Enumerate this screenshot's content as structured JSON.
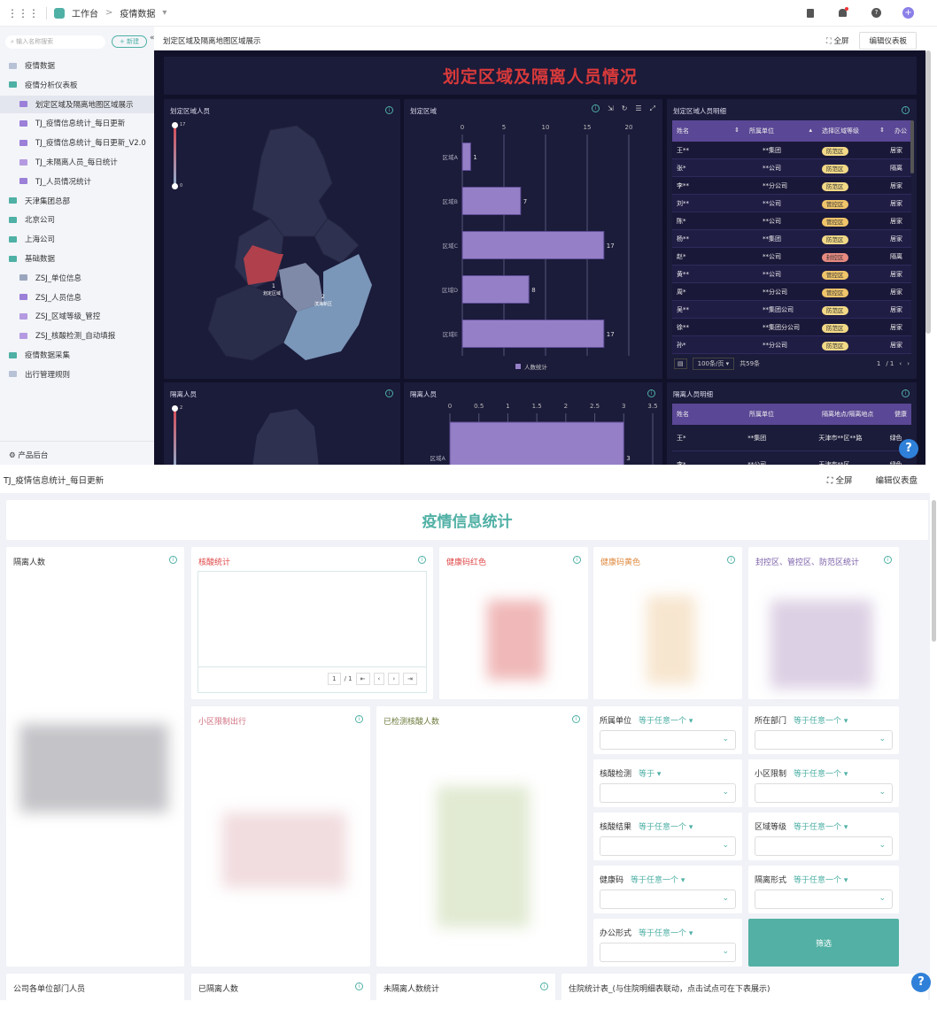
{
  "topbar": {
    "workspace": "工作台",
    "separator": ">",
    "project": "疫情数据"
  },
  "sidebar": {
    "search_placeholder": "输入名称搜索",
    "new_label": "+ 新建",
    "collapse": "«",
    "items": [
      {
        "label": "疫情数据",
        "type": "sheet",
        "indent": 0
      },
      {
        "label": "疫情分析仪表板",
        "type": "folder",
        "indent": 0
      },
      {
        "label": "划定区域及隔离地图区域展示",
        "type": "dashboard",
        "indent": 1,
        "selected": true
      },
      {
        "label": "TJ_疫情信息统计_每日更新",
        "type": "dashboard",
        "indent": 1
      },
      {
        "label": "TJ_疫情信息统计_每日更新_V2.0",
        "type": "dashboard",
        "indent": 1
      },
      {
        "label": "TJ_未隔离人员_每日统计",
        "type": "report",
        "indent": 1
      },
      {
        "label": "TJ_人员情况统计",
        "type": "user",
        "indent": 1
      },
      {
        "label": "天津集团总部",
        "type": "folder",
        "indent": 0
      },
      {
        "label": "北京公司",
        "type": "folder",
        "indent": 0
      },
      {
        "label": "上海公司",
        "type": "folder",
        "indent": 0
      },
      {
        "label": "基础数据",
        "type": "folder",
        "indent": 0
      },
      {
        "label": "ZSJ_单位信息",
        "type": "globe",
        "indent": 1
      },
      {
        "label": "ZSJ_人员信息",
        "type": "user",
        "indent": 1
      },
      {
        "label": "ZSJ_区域等级_管控",
        "type": "report",
        "indent": 1
      },
      {
        "label": "ZSJ_核酸检测_自动填报",
        "type": "report",
        "indent": 1
      },
      {
        "label": "疫情数据采集",
        "type": "folder",
        "indent": 0
      },
      {
        "label": "出行管理规则",
        "type": "sheet",
        "indent": 0
      }
    ],
    "footer": "产品后台"
  },
  "dashboard1": {
    "breadcrumb": "划定区域及隔离地图区域展示",
    "fullscreen": "全屏",
    "edit": "编辑仪表板",
    "title": "划定区域及隔离人员情况",
    "map1": {
      "title": "划定区域人员",
      "legend_max": "17",
      "legend_min": "0",
      "labels": [
        "1",
        "划定区域",
        "2",
        "滨海新区"
      ]
    },
    "map2": {
      "title": "隔离人员",
      "legend_max": "2"
    },
    "table1": {
      "title": "划定区域人员明细",
      "columns": [
        "姓名",
        "所属单位",
        "选择区域等级",
        "办公"
      ],
      "rows": [
        [
          "王**",
          "**集团",
          "防范区",
          "居家"
        ],
        [
          "张*",
          "**公司",
          "防范区",
          "隔离"
        ],
        [
          "李**",
          "**分公司",
          "防范区",
          "居家"
        ],
        [
          "刘**",
          "**公司",
          "管控区",
          "居家"
        ],
        [
          "陈*",
          "**公司",
          "管控区",
          "居家"
        ],
        [
          "杨**",
          "**集团",
          "防范区",
          "居家"
        ],
        [
          "赵*",
          "**公司",
          "封控区",
          "隔离"
        ],
        [
          "黄**",
          "**公司",
          "管控区",
          "居家"
        ],
        [
          "周*",
          "**分公司",
          "管控区",
          "居家"
        ],
        [
          "吴**",
          "**集团公司",
          "防范区",
          "居家"
        ],
        [
          "徐**",
          "**集团分公司",
          "防范区",
          "居家"
        ],
        [
          "孙*",
          "**分公司",
          "防范区",
          "居家"
        ]
      ],
      "page_size": "100条/页",
      "total": "共59条",
      "page": "1",
      "pages": "/ 1"
    },
    "table2": {
      "title": "隔离人员明细",
      "columns": [
        "姓名",
        "所属单位",
        "隔离地点/隔离地点",
        "健康"
      ],
      "rows": [
        [
          "王*",
          "**集团",
          "天津市**区**路",
          "绿色"
        ],
        [
          "李*",
          "**公司",
          "天津市**区",
          "绿色"
        ]
      ]
    }
  },
  "dashboard2": {
    "breadcrumb": "TJ_疫情信息统计_每日更新",
    "fullscreen": "全屏",
    "edit": "编辑仪表盘",
    "title": "疫情信息统计",
    "cards": {
      "isolated": "隔离人数",
      "nucleic": "核酸统计",
      "red_code": "健康码红色",
      "yellow_code": "健康码黄色",
      "zones": "封控区、管控区、防范区统计",
      "community": "小区限制出行",
      "tested": "已检测核酸人数",
      "company": "公司各单位部门人员",
      "isolated2": "已隔离人数",
      "not_isolated": "未隔离人数统计",
      "hospital": "住院统计表_(与住院明细表联动，点击试点可在下表展示)"
    },
    "pager": {
      "page": "1",
      "pages": "/ 1"
    },
    "filters": [
      {
        "label": "所属单位",
        "op": "等于任意一个"
      },
      {
        "label": "所在部门",
        "op": "等于任意一个"
      },
      {
        "label": "核酸检测",
        "op": "等于"
      },
      {
        "label": "小区限制",
        "op": "等于任意一个"
      },
      {
        "label": "核酸结果",
        "op": "等于任意一个"
      },
      {
        "label": "区域等级",
        "op": "等于任意一个"
      },
      {
        "label": "健康码",
        "op": "等于任意一个"
      },
      {
        "label": "隔离形式",
        "op": "等于任意一个"
      },
      {
        "label": "办公形式",
        "op": "等于任意一个"
      }
    ],
    "filter_button": "筛选"
  },
  "help": "?",
  "colors": {
    "accent": "#4fb0a5",
    "dark_bg": "#11112a",
    "panel": "#1b1b3a",
    "bar": "#9580c8",
    "title_red": "#d93a3a",
    "header_purple": "#5a4795"
  },
  "chart_data": [
    {
      "type": "bar",
      "orientation": "horizontal",
      "title": "划定区域",
      "categories": [
        "区域A",
        "区域B",
        "区域C",
        "区域D",
        "区域E"
      ],
      "series": [
        {
          "name": "人数统计",
          "values": [
            1,
            7,
            17,
            8,
            17
          ]
        }
      ],
      "xlim": [
        0,
        20
      ],
      "ticks": [
        0,
        5,
        10,
        15,
        20
      ]
    },
    {
      "type": "bar",
      "orientation": "horizontal",
      "title": "隔离人员",
      "categories": [
        "区域A"
      ],
      "series": [
        {
          "name": "人数统计",
          "values": [
            3
          ]
        }
      ],
      "xlim": [
        0,
        3.5
      ],
      "ticks": [
        0,
        0.5,
        1,
        1.5,
        2,
        2.5,
        3,
        3.5
      ]
    }
  ]
}
